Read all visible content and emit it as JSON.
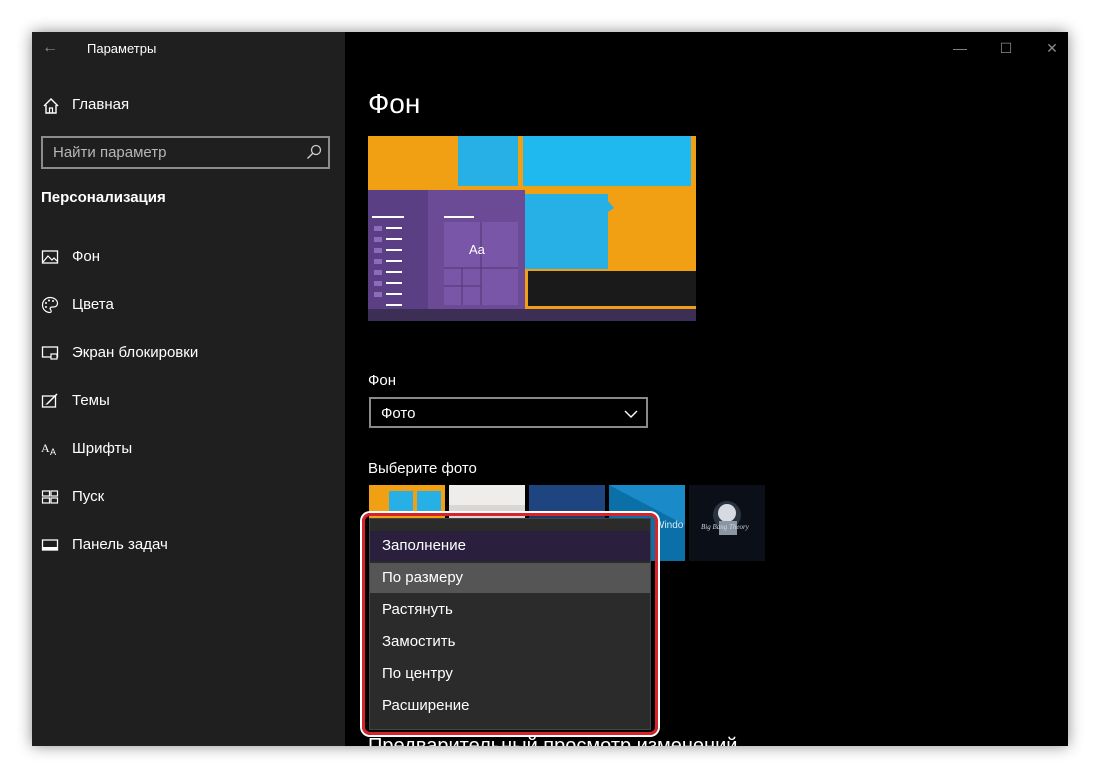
{
  "window": {
    "app_title": "Параметры",
    "controls": {
      "minimize": "—",
      "maximize": "☐",
      "close": "✕"
    }
  },
  "sidebar": {
    "home_label": "Главная",
    "search_placeholder": "Найти параметр",
    "section_title": "Персонализация",
    "items": [
      {
        "label": "Фон",
        "icon": "picture-icon"
      },
      {
        "label": "Цвета",
        "icon": "palette-icon"
      },
      {
        "label": "Экран блокировки",
        "icon": "lock-screen-icon"
      },
      {
        "label": "Темы",
        "icon": "themes-icon"
      },
      {
        "label": "Шрифты",
        "icon": "fonts-icon"
      },
      {
        "label": "Пуск",
        "icon": "start-icon"
      },
      {
        "label": "Панель задач",
        "icon": "taskbar-icon"
      }
    ]
  },
  "main": {
    "page_title": "Фон",
    "preview": {
      "tile_text": "Aa"
    },
    "background_label": "Фон",
    "background_value": "Фото",
    "choose_photo_label": "Выберите фото",
    "thumb_text": {
      "windows": "Windo",
      "big_bang": "Big Bang Theory"
    },
    "fit_menu": {
      "items": [
        "Заполнение",
        "По размеру",
        "Растянуть",
        "Замостить",
        "По центру",
        "Расширение"
      ],
      "selected": "Заполнение",
      "hovered": "По размеру"
    },
    "preview_heading": "Предварительный просмотр изменений"
  },
  "colors": {
    "accent_orange": "#f0a012",
    "accent_purple": "#6b4a96",
    "highlight_red": "#d8232a"
  }
}
